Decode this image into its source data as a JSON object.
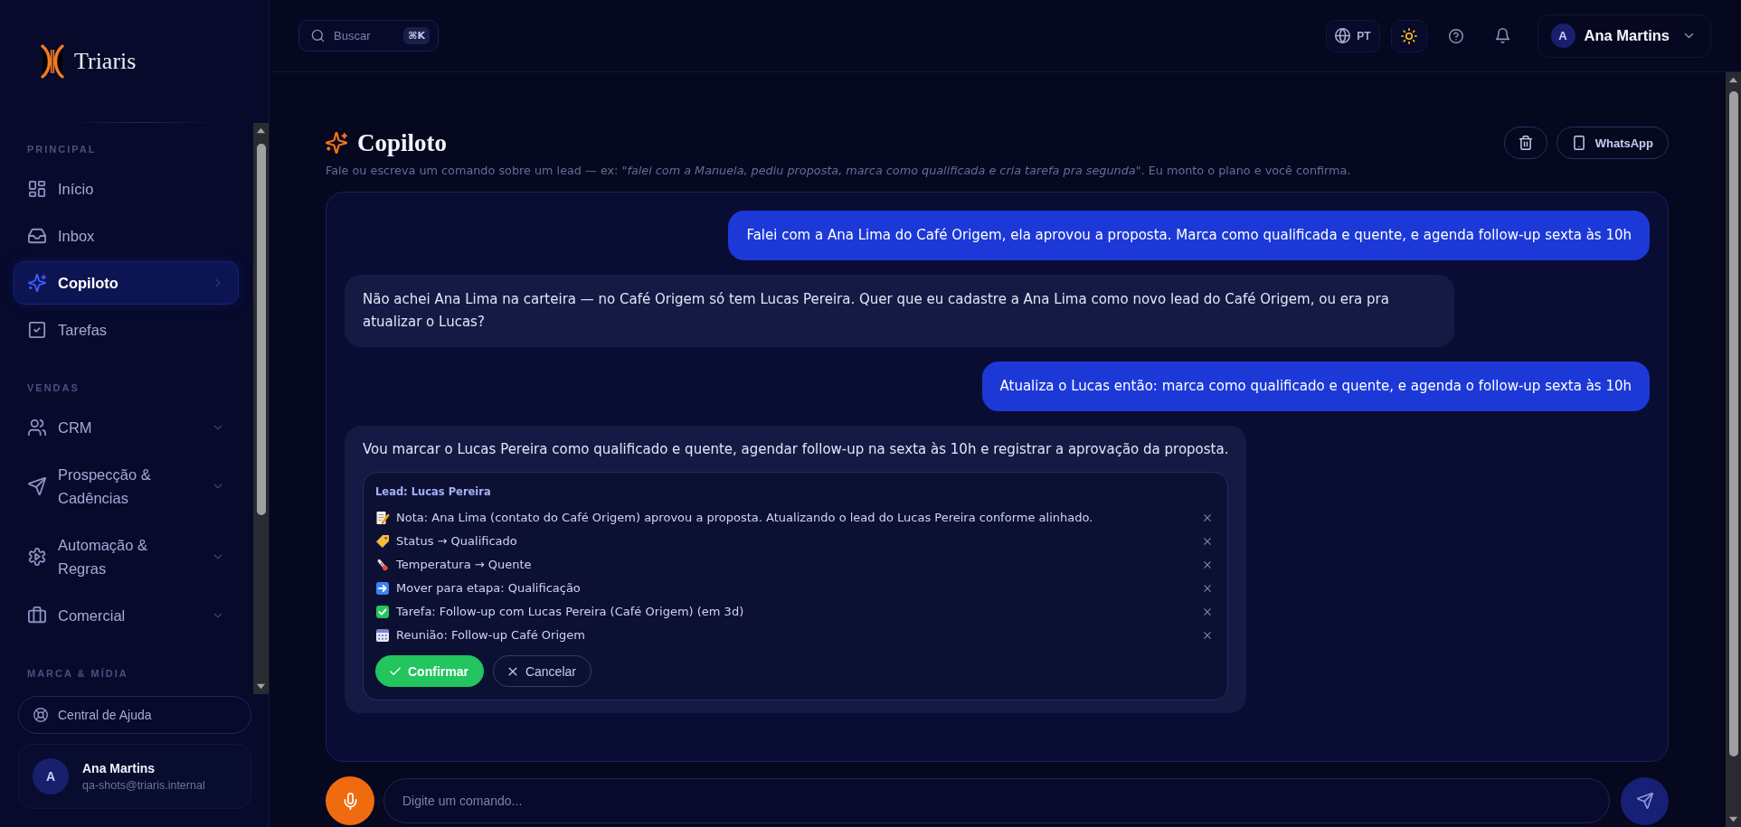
{
  "sidebar": {
    "brand": "Triaris",
    "sections": [
      {
        "title": "PRINCIPAL",
        "items": [
          {
            "kind": "home",
            "label": "Início",
            "selected": false
          },
          {
            "kind": "inbox",
            "label": "Inbox",
            "selected": false
          },
          {
            "kind": "copilot",
            "label": "Copiloto",
            "selected": true
          },
          {
            "kind": "tasks",
            "label": "Tarefas",
            "selected": false
          }
        ]
      },
      {
        "title": "VENDAS",
        "items": [
          {
            "kind": "crm",
            "label": "CRM",
            "selected": false,
            "expanded": false
          },
          {
            "kind": "prospecting",
            "label": "Prospecção & Cadências",
            "selected": false,
            "expanded": false
          },
          {
            "kind": "automation",
            "label": "Automação & Regras",
            "selected": false,
            "expanded": false
          },
          {
            "kind": "commercial",
            "label": "Comercial",
            "selected": false,
            "expanded": false
          }
        ]
      },
      {
        "title": "MARCA & MÍDIA"
      }
    ],
    "help": "Central de Ajuda",
    "user": {
      "initial": "A",
      "name": "Ana Martins",
      "email": "qa-shots@triaris.internal"
    }
  },
  "topbar": {
    "search": {
      "placeholder": "Buscar",
      "shortcut": "⌘K"
    },
    "language": "PT",
    "user": {
      "initial": "A",
      "name": "Ana Martins"
    }
  },
  "header": {
    "title": "Copiloto",
    "subtitle": "Fale ou escreva um comando sobre um lead — ex: *\"falei com a Manuela, pediu proposta, marca como qualificada e cria tarefa pra segunda\"*. Eu monto o plano e você confirma.",
    "actions": [
      {
        "kind": "clear"
      },
      {
        "kind": "whatsapp",
        "label": "WhatsApp"
      }
    ]
  },
  "chat": {
    "messages": [
      {
        "kind": "user",
        "text": "Falei com a Ana Lima do Café Origem, ela aprovou a proposta. Marca como qualificada e quente, e agenda follow-up sexta às 10h"
      },
      {
        "kind": "assistant",
        "text": "Não achei Ana Lima na carteira — no Café Origem só tem Lucas Pereira. Quer que eu cadastre a Ana Lima como novo lead do Café Origem, ou era pra atualizar o Lucas?"
      },
      {
        "kind": "user",
        "text": "Atualiza o Lucas então: marca como qualificado e quente, e agenda o follow-up sexta às 10h"
      },
      {
        "kind": "assistant",
        "text": "Vou marcar o Lucas Pereira como qualificado e quente, agendar follow-up na sexta às 10h e registrar a aprovação da proposta.",
        "plan": {
          "lead": "Lead: Lucas Pereira",
          "actions": [
            {
              "kind": "note",
              "text": "Nota: Ana Lima (contato do Café Origem) aprovou a proposta. Atualizando o lead do Lucas Pereira conforme alinhado."
            },
            {
              "kind": "status",
              "text": "Status → Qualificado"
            },
            {
              "kind": "temperature",
              "text": "Temperatura → Quente"
            },
            {
              "kind": "stage",
              "text": "Mover para etapa: Qualificação"
            },
            {
              "kind": "task",
              "text": "Tarefa: Follow-up com Lucas Pereira (Café Origem) (em 3d)"
            },
            {
              "kind": "meeting",
              "text": "Reunião: Follow-up Café Origem"
            }
          ],
          "buttons": [
            {
              "kind": "confirm",
              "label": "Confirmar"
            },
            {
              "kind": "cancel",
              "label": "Cancelar"
            }
          ]
        }
      }
    ]
  },
  "composer": {
    "placeholder": "Digite um comando..."
  }
}
